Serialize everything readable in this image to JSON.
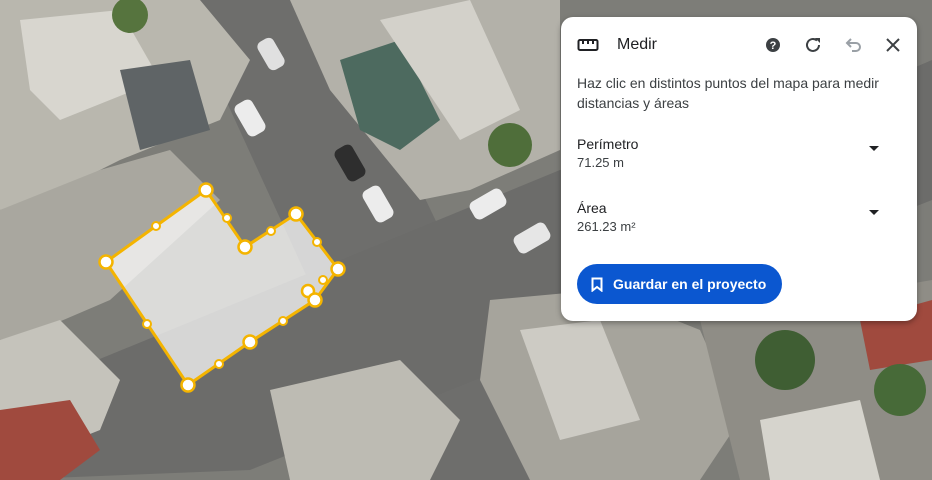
{
  "panel": {
    "title": "Medir",
    "description": "Haz clic en distintos puntos del mapa para medir distancias y áreas",
    "perimeter": {
      "label": "Perímetro",
      "value": "71.25 m"
    },
    "area": {
      "label": "Área",
      "value": "261.23 m²"
    },
    "save_label": "Guardar en el proyecto"
  },
  "colors": {
    "accent": "#0b57d0",
    "measure_line": "#f4b400",
    "panel_bg": "#ffffff"
  },
  "icons": [
    "ruler-icon",
    "help-icon",
    "refresh-icon",
    "undo-icon",
    "close-icon",
    "chevron-down-icon",
    "bookmark-icon"
  ]
}
